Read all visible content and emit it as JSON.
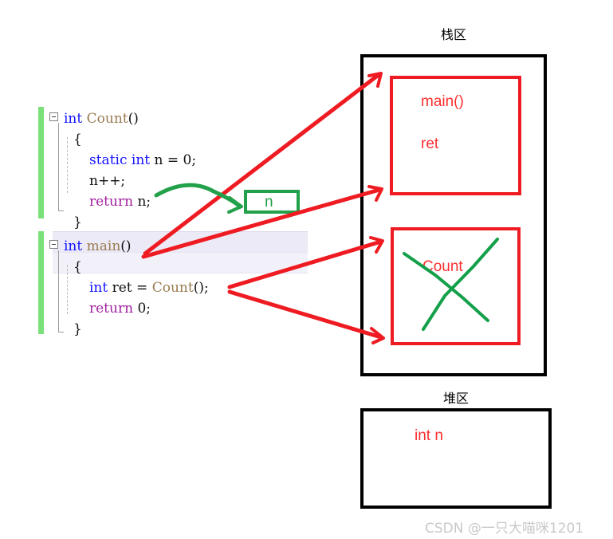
{
  "code": {
    "lines": [
      {
        "indent": 0,
        "tokens": [
          {
            "t": "int ",
            "c": "kw"
          },
          {
            "t": "Count",
            "c": "fn"
          },
          {
            "t": "()",
            "c": "plain"
          }
        ]
      },
      {
        "indent": 1,
        "tokens": [
          {
            "t": "{",
            "c": "plain"
          }
        ]
      },
      {
        "indent": 2,
        "tokens": [
          {
            "t": "static int",
            "c": "kw"
          },
          {
            "t": " n = 0;",
            "c": "plain"
          }
        ]
      },
      {
        "indent": 2,
        "tokens": [
          {
            "t": "n++;",
            "c": "plain"
          }
        ]
      },
      {
        "indent": 2,
        "tokens": [
          {
            "t": "return",
            "c": "ctl"
          },
          {
            "t": " n;",
            "c": "plain"
          }
        ]
      },
      {
        "indent": 1,
        "tokens": [
          {
            "t": "}",
            "c": "plain"
          }
        ]
      },
      {
        "indent": 0,
        "tokens": [
          {
            "t": "int ",
            "c": "kw"
          },
          {
            "t": "main",
            "c": "fn"
          },
          {
            "t": "()",
            "c": "plain"
          }
        ]
      },
      {
        "indent": 1,
        "tokens": [
          {
            "t": "{",
            "c": "plain"
          }
        ]
      },
      {
        "indent": 2,
        "tokens": [
          {
            "t": "int",
            "c": "kw"
          },
          {
            "t": " ret = ",
            "c": "plain"
          },
          {
            "t": "Count",
            "c": "fn"
          },
          {
            "t": "();",
            "c": "plain"
          }
        ]
      },
      {
        "indent": 2,
        "tokens": [
          {
            "t": "return",
            "c": "ctl"
          },
          {
            "t": " 0;",
            "c": "plain"
          }
        ]
      },
      {
        "indent": 1,
        "tokens": [
          {
            "t": "}",
            "c": "plain"
          }
        ]
      }
    ],
    "plain_text": [
      "int Count()",
      "{",
      "    static int n = 0;",
      "    n++;",
      "    return n;",
      "}",
      "int main()",
      "{",
      "    int ret = Count();",
      "    return 0;",
      "}"
    ]
  },
  "annotation": {
    "variable_box_label": "n"
  },
  "stack_region": {
    "title": "栈区",
    "frames": [
      {
        "name": "main-frame",
        "labels": [
          "main()",
          "ret"
        ],
        "crossed_out": false
      },
      {
        "name": "count-frame",
        "labels": [
          "Count"
        ],
        "crossed_out": true
      }
    ]
  },
  "heap_region": {
    "title": "堆区",
    "labels": [
      "int n"
    ]
  },
  "watermark": {
    "text": "CSDN @一只大喵咪1201"
  },
  "colors": {
    "keyword_blue": "#1414ff",
    "control_purple": "#a020a0",
    "function_tan": "#9a7b50",
    "annotation_red": "#ee1c22",
    "annotation_green": "#22a14a",
    "region_border": "#000000",
    "changebar_green": "#7ae07a",
    "watermark_gray": "#c9c9c9"
  }
}
